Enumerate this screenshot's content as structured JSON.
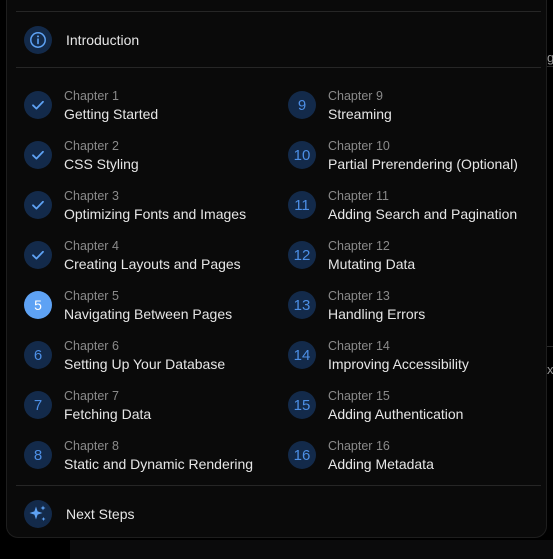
{
  "intro": {
    "title": "Introduction",
    "icon": "info-icon"
  },
  "next": {
    "title": "Next Steps",
    "icon": "sparkles-icon"
  },
  "colors": {
    "accent": "#5ea2f4",
    "badge_bg": "#132a4a",
    "badge_text": "#4d8fe6"
  },
  "chapters": [
    {
      "label": "Chapter 1",
      "title": "Getting Started",
      "number": "1",
      "status": "done"
    },
    {
      "label": "Chapter 2",
      "title": "CSS Styling",
      "number": "2",
      "status": "done"
    },
    {
      "label": "Chapter 3",
      "title": "Optimizing Fonts and Images",
      "number": "3",
      "status": "done"
    },
    {
      "label": "Chapter 4",
      "title": "Creating Layouts and Pages",
      "number": "4",
      "status": "done"
    },
    {
      "label": "Chapter 5",
      "title": "Navigating Between Pages",
      "number": "5",
      "status": "current"
    },
    {
      "label": "Chapter 6",
      "title": "Setting Up Your Database",
      "number": "6",
      "status": "todo"
    },
    {
      "label": "Chapter 7",
      "title": "Fetching Data",
      "number": "7",
      "status": "todo"
    },
    {
      "label": "Chapter 8",
      "title": "Static and Dynamic Rendering",
      "number": "8",
      "status": "todo"
    },
    {
      "label": "Chapter 9",
      "title": "Streaming",
      "number": "9",
      "status": "todo"
    },
    {
      "label": "Chapter 10",
      "title": "Partial Prerendering (Optional)",
      "number": "10",
      "status": "todo"
    },
    {
      "label": "Chapter 11",
      "title": "Adding Search and Pagination",
      "number": "11",
      "status": "todo"
    },
    {
      "label": "Chapter 12",
      "title": "Mutating Data",
      "number": "12",
      "status": "todo"
    },
    {
      "label": "Chapter 13",
      "title": "Handling Errors",
      "number": "13",
      "status": "todo"
    },
    {
      "label": "Chapter 14",
      "title": "Improving Accessibility",
      "number": "14",
      "status": "todo"
    },
    {
      "label": "Chapter 15",
      "title": "Adding Authentication",
      "number": "15",
      "status": "todo"
    },
    {
      "label": "Chapter 16",
      "title": "Adding Metadata",
      "number": "16",
      "status": "todo"
    }
  ],
  "background": {
    "edge_text_1": "g",
    "edge_text_2": "x"
  }
}
